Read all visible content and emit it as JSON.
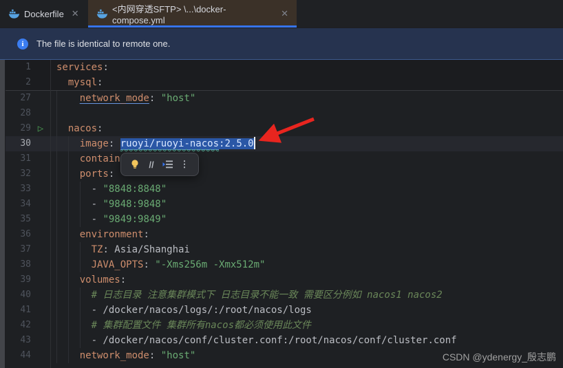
{
  "tabs": [
    {
      "label": "Dockerfile",
      "icon": "docker-icon",
      "active": false
    },
    {
      "label": "<内网穿透SFTP> \\...\\docker-compose.yml",
      "icon": "docker-icon",
      "active": true
    }
  ],
  "banner": {
    "icon": "info-icon",
    "text": "The file is identical to remote one."
  },
  "editor": {
    "sticky_lines": [
      {
        "num": "1",
        "segs": [
          [
            "k",
            "services"
          ],
          [
            "p",
            ":"
          ]
        ]
      },
      {
        "num": "2",
        "segs": [
          [
            "p",
            "  "
          ],
          [
            "k",
            "mysql"
          ],
          [
            "p",
            ":"
          ]
        ]
      }
    ],
    "lines": [
      {
        "num": "27",
        "segs": [
          [
            "p",
            "    "
          ],
          [
            "ku",
            "network_mode"
          ],
          [
            "p",
            ": "
          ],
          [
            "s",
            "\"host\""
          ]
        ]
      },
      {
        "num": "28",
        "segs": []
      },
      {
        "num": "29",
        "run": true,
        "segs": [
          [
            "p",
            "  "
          ],
          [
            "k",
            "nacos"
          ],
          [
            "p",
            ":"
          ]
        ]
      },
      {
        "num": "30",
        "current": true,
        "segs": [
          [
            "p",
            "    "
          ],
          [
            "k",
            "image"
          ],
          [
            "p",
            ": "
          ],
          [
            "selw",
            "ruoyi/ruoyi-nacos"
          ],
          [
            "sel",
            ":2.5.0"
          ],
          [
            "caret",
            ""
          ]
        ]
      },
      {
        "num": "31",
        "segs": [
          [
            "p",
            "    "
          ],
          [
            "k",
            "contain"
          ]
        ]
      },
      {
        "num": "32",
        "segs": [
          [
            "p",
            "    "
          ],
          [
            "k",
            "ports"
          ],
          [
            "p",
            ":"
          ]
        ]
      },
      {
        "num": "33",
        "segs": [
          [
            "p",
            "      - "
          ],
          [
            "s",
            "\"8848:8848\""
          ]
        ]
      },
      {
        "num": "34",
        "segs": [
          [
            "p",
            "      - "
          ],
          [
            "s",
            "\"9848:9848\""
          ]
        ]
      },
      {
        "num": "35",
        "segs": [
          [
            "p",
            "      - "
          ],
          [
            "s",
            "\"9849:9849\""
          ]
        ]
      },
      {
        "num": "36",
        "segs": [
          [
            "p",
            "    "
          ],
          [
            "k",
            "environment"
          ],
          [
            "p",
            ":"
          ]
        ]
      },
      {
        "num": "37",
        "segs": [
          [
            "p",
            "      "
          ],
          [
            "k",
            "TZ"
          ],
          [
            "p",
            ": Asia/Shanghai"
          ]
        ]
      },
      {
        "num": "38",
        "segs": [
          [
            "p",
            "      "
          ],
          [
            "k",
            "JAVA_OPTS"
          ],
          [
            "p",
            ": "
          ],
          [
            "s",
            "\"-Xms256m -Xmx512m\""
          ]
        ]
      },
      {
        "num": "39",
        "segs": [
          [
            "p",
            "    "
          ],
          [
            "k",
            "volumes"
          ],
          [
            "p",
            ":"
          ]
        ]
      },
      {
        "num": "40",
        "segs": [
          [
            "p",
            "      "
          ],
          [
            "c",
            "# 日志目录 注意集群模式下 日志目录不能一致 需要区分例如 nacos1 nacos2"
          ]
        ]
      },
      {
        "num": "41",
        "segs": [
          [
            "p",
            "      - /docker/nacos/logs/:/root/nacos/logs"
          ]
        ]
      },
      {
        "num": "42",
        "segs": [
          [
            "p",
            "      "
          ],
          [
            "c",
            "# 集群配置文件 集群所有nacos都必须使用此文件"
          ]
        ]
      },
      {
        "num": "43",
        "segs": [
          [
            "p",
            "      - /docker/nacos/conf/cluster.conf:/root/nacos/conf/cluster.conf"
          ]
        ]
      },
      {
        "num": "44",
        "segs": [
          [
            "p",
            "    "
          ],
          [
            "k",
            "network_mode"
          ],
          [
            "p",
            ": "
          ],
          [
            "s",
            "\"host\""
          ]
        ]
      }
    ]
  },
  "popup": {
    "icons": [
      "lightbulb-icon",
      "comment-icon",
      "context-actions-icon",
      "more-icon"
    ]
  },
  "annotation": {
    "arrow_color": "#e8251f"
  },
  "watermark": "CSDN @ydenergy_殷志鹏",
  "colors": {
    "accent_blue": "#3674f0",
    "selection_blue": "#2a57a6",
    "key_orange": "#cf8e6d",
    "string_green": "#6aab73",
    "banner_navy": "#26334f",
    "active_tab_brown": "#3b3128"
  }
}
